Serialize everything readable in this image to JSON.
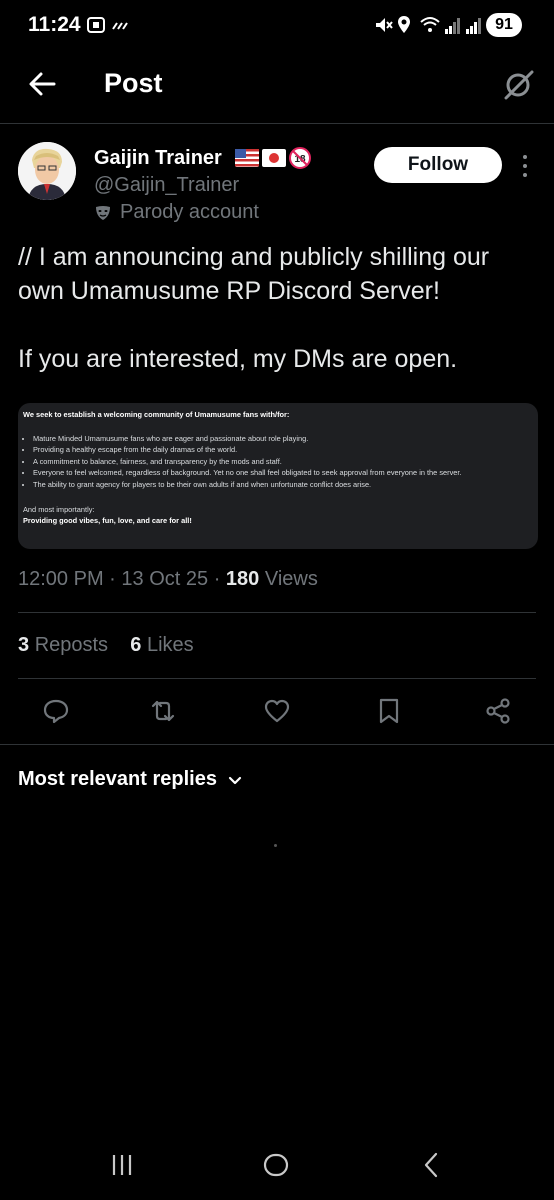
{
  "status_bar": {
    "time": "11:24",
    "battery": "91"
  },
  "header": {
    "title": "Post"
  },
  "author": {
    "name": "Gaijin Trainer",
    "handle": "@Gaijin_Trainer",
    "label": "Parody account",
    "follow_label": "Follow"
  },
  "post": {
    "line1": "// I am announcing and publicly shilling our own Umamusume RP Discord Server!",
    "line2": "If you are interested, my DMs are open."
  },
  "image_card": {
    "heading": "We seek to establish a welcoming community of Umamusume fans with/for:",
    "bullets": [
      "Mature Minded Umamusume fans who are eager and passionate about role playing.",
      "Providing a healthy escape from the daily dramas of the world.",
      "A commitment to balance, fairness, and transparency by the mods and staff.",
      "Everyone to feel welcomed, regardless of background. Yet no one shall feel obligated to seek approval from everyone in the server.",
      "The ability to grant agency for players to be their own adults if and when unfortunate conflict does arise."
    ],
    "footer1": "And most importantly:",
    "footer2": "Providing good vibes, fun, love, and care for all!"
  },
  "meta": {
    "time": "12:00 PM",
    "date": "13 Oct 25",
    "views_count": "180",
    "views_label": "Views",
    "sep": "·"
  },
  "stats": {
    "reposts_count": "3",
    "reposts_label": "Reposts",
    "likes_count": "6",
    "likes_label": "Likes"
  },
  "replies": {
    "label": "Most relevant replies"
  },
  "icons": {
    "back": "arrow-left-icon",
    "grok": "grok-icon",
    "reply": "reply-icon",
    "repost": "repost-icon",
    "like": "heart-icon",
    "bookmark": "bookmark-icon",
    "share": "share-icon"
  },
  "colors": {
    "background": "#000000",
    "text": "#e7e9ea",
    "muted": "#71767b",
    "divider": "#2f3336"
  }
}
